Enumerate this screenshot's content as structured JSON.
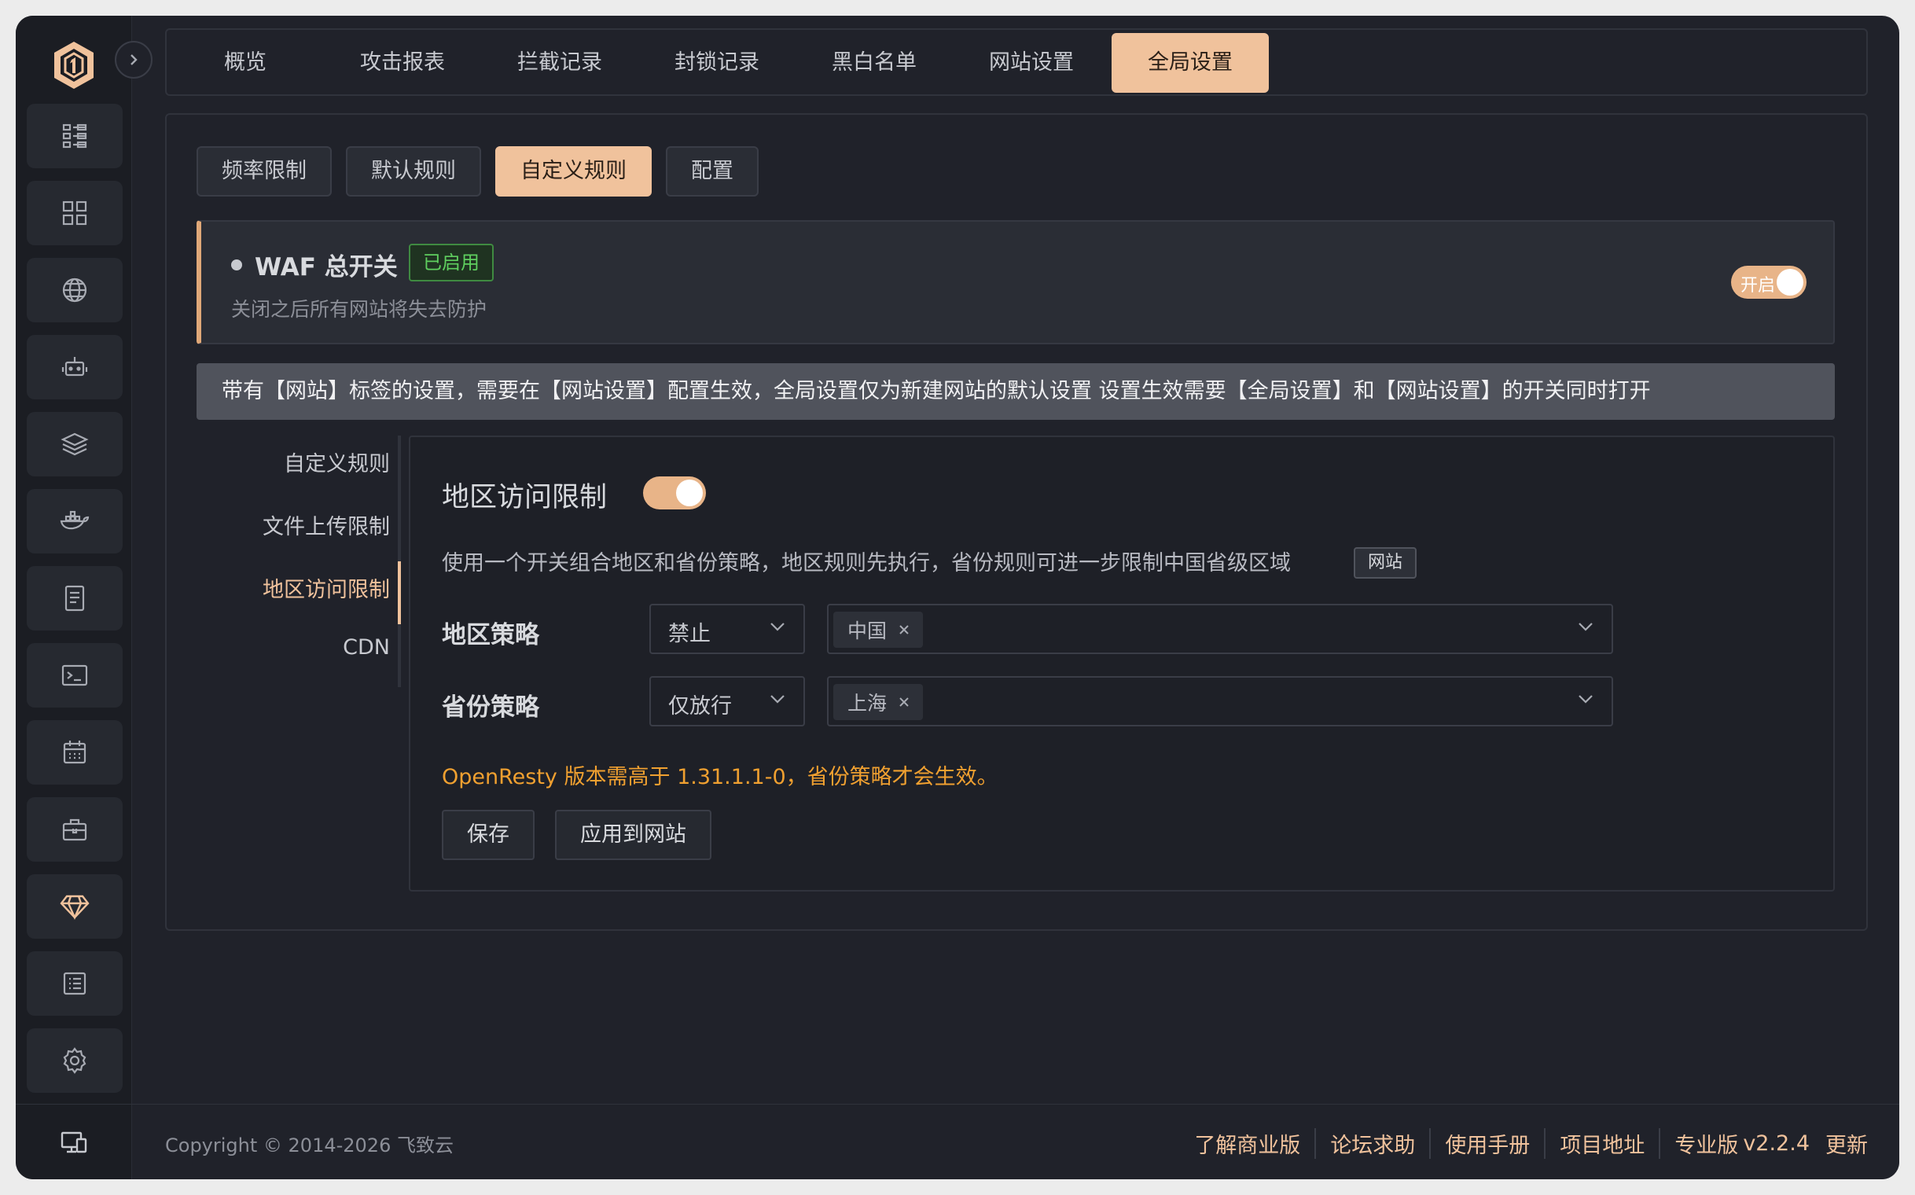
{
  "sidebar": {
    "items": [
      {
        "icon": "dashboard-list-icon"
      },
      {
        "icon": "grid-icon"
      },
      {
        "icon": "globe-icon"
      },
      {
        "icon": "robot-icon"
      },
      {
        "icon": "layers-icon"
      },
      {
        "icon": "docker-icon"
      },
      {
        "icon": "file-icon"
      },
      {
        "icon": "terminal-icon"
      },
      {
        "icon": "calendar-icon"
      },
      {
        "icon": "toolbox-icon"
      },
      {
        "icon": "diamond-icon"
      },
      {
        "icon": "log-icon"
      },
      {
        "icon": "settings-icon"
      }
    ],
    "bottom_icon": "monitor-icon"
  },
  "topnav": {
    "tabs": [
      "概览",
      "攻击报表",
      "拦截记录",
      "封锁记录",
      "黑白名单",
      "网站设置",
      "全局设置"
    ],
    "active": "全局设置"
  },
  "subtabs": {
    "items": [
      "频率限制",
      "默认规则",
      "自定义规则",
      "配置"
    ],
    "active": "自定义规则"
  },
  "waf": {
    "title": "WAF 总开关",
    "badge": "已启用",
    "desc": "关闭之后所有网站将失去防护",
    "toggle_label": "开启",
    "enabled": true
  },
  "notice": "带有【网站】标签的设置，需要在【网站设置】配置生效，全局设置仅为新建网站的默认设置 设置生效需要【全局设置】和【网站设置】的开关同时打开",
  "leftmenu": {
    "items": [
      "自定义规则",
      "文件上传限制",
      "地区访问限制",
      "CDN"
    ],
    "active": "地区访问限制"
  },
  "content": {
    "title": "地区访问限制",
    "toggle_on": true,
    "desc": "使用一个开关组合地区和省份策略，地区规则先执行，省份规则可进一步限制中国省级区域",
    "tag": "网站",
    "region": {
      "label": "地区策略",
      "policy": "禁止",
      "chip": "中国"
    },
    "province": {
      "label": "省份策略",
      "policy": "仅放行",
      "chip": "上海"
    },
    "warning": "OpenResty 版本需高于 1.31.1.1-0，省份策略才会生效。",
    "save_label": "保存",
    "apply_label": "应用到网站"
  },
  "footer": {
    "copyright": "Copyright © 2014-2026 飞致云",
    "links": [
      "了解商业版",
      "论坛求助",
      "使用手册",
      "项目地址",
      "专业版"
    ],
    "version": "v2.2.4",
    "update": "更新"
  },
  "colors": {
    "accent": "#f0c29c",
    "background": "#20222a",
    "warning": "#f0a030",
    "success": "#5fcf5f"
  }
}
